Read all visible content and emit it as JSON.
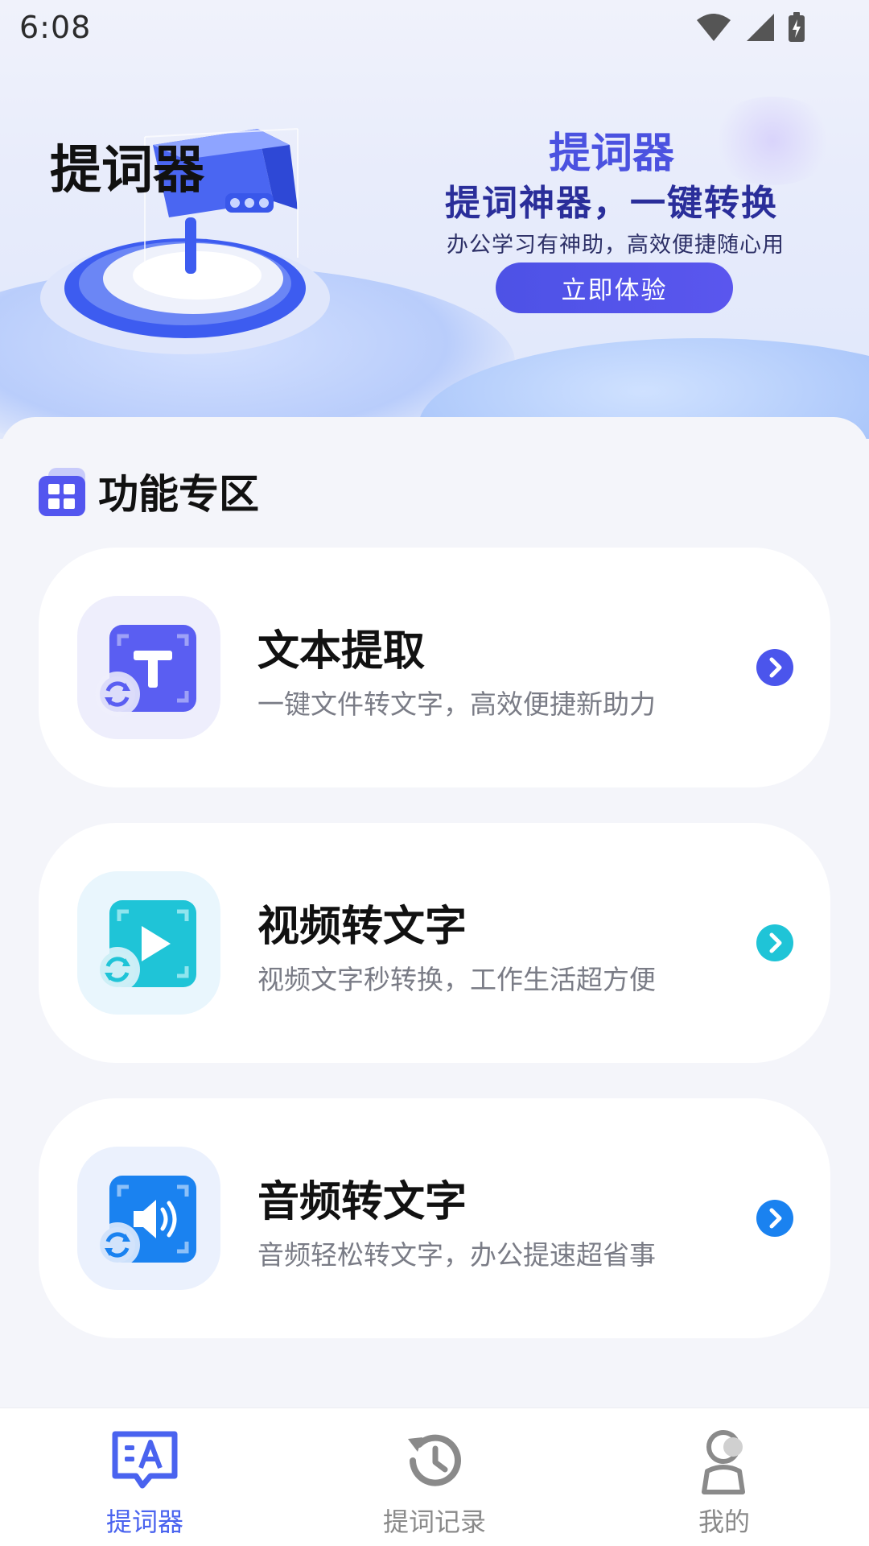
{
  "status_bar": {
    "time": "6:08"
  },
  "hero": {
    "title": "提词器",
    "promo_title": "提词器",
    "promo_line1": "提词神器，一键转换",
    "promo_line2": "办公学习有神助，高效便捷随心用",
    "cta_label": "立即体验"
  },
  "section": {
    "title": "功能专区"
  },
  "features": [
    {
      "title": "文本提取",
      "desc": "一键文件转文字，高效便捷新助力",
      "accent": "#5a5ef2",
      "tile_bg": "#eeeefc",
      "icon": "text-t-icon"
    },
    {
      "title": "视频转文字",
      "desc": "视频文字秒转换，工作生活超方便",
      "accent": "#1fc4d7",
      "tile_bg": "#e9f6fd",
      "icon": "play-icon"
    },
    {
      "title": "音频转文字",
      "desc": "音频轻松转文字，办公提速超省事",
      "accent": "#1a82f0",
      "tile_bg": "#ebf1fd",
      "icon": "speaker-icon"
    }
  ],
  "nav": {
    "items": [
      {
        "label": "提词器",
        "active": true
      },
      {
        "label": "提词记录",
        "active": false
      },
      {
        "label": "我的",
        "active": false
      }
    ],
    "active_color": "#4a63ef",
    "inactive_color": "#8a8a8a"
  }
}
